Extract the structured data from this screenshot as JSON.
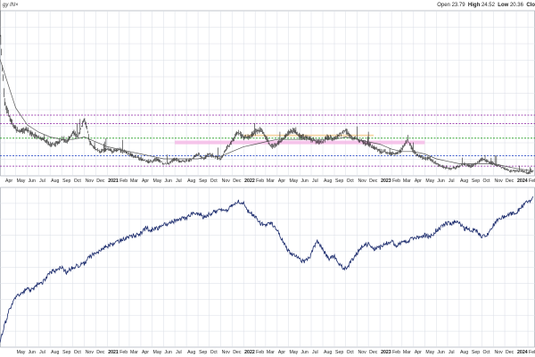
{
  "header": {
    "symbol_label": "gy IN×",
    "open_label": "Open",
    "open_value": "23.79",
    "high_label": "High",
    "high_value": "24.52",
    "low_label": "Low",
    "low_value": "20.36",
    "close_label": "Clo"
  },
  "colors": {
    "price_bar": "#111111",
    "moving_average": "#555555",
    "line_chart": "#1a2a6c",
    "grid": "#d9dde6",
    "level_purple": "#8a1fa0",
    "level_green": "#1a9a1a",
    "level_blue": "#3050c8",
    "band_pink": "#f5b8e6",
    "band_orange": "#f7d09a"
  },
  "chart_data": [
    {
      "type": "line",
      "panel": "upper",
      "series": [
        {
          "style": "price-bars",
          "x": [
            "2020-03-20",
            "2020-04-01",
            "2020-04-15",
            "2020-05-01",
            "2020-05-15",
            "2020-06-01",
            "2020-06-15",
            "2020-07-01",
            "2020-07-15",
            "2020-08-01",
            "2020-08-15",
            "2020-09-01",
            "2020-09-15",
            "2020-10-01",
            "2020-10-15",
            "2020-11-01",
            "2020-11-15",
            "2020-12-01",
            "2020-12-15",
            "2021-01-01",
            "2021-01-15",
            "2021-02-01",
            "2021-02-15",
            "2021-03-01",
            "2021-03-15",
            "2021-04-01",
            "2021-04-15",
            "2021-05-01",
            "2021-05-15",
            "2021-06-01",
            "2021-06-15",
            "2021-07-01",
            "2021-07-15",
            "2021-08-01",
            "2021-08-15",
            "2021-09-01",
            "2021-09-15",
            "2021-10-01",
            "2021-10-15",
            "2021-11-01",
            "2021-11-15",
            "2021-12-01",
            "2021-12-15",
            "2022-01-01",
            "2022-01-15",
            "2022-02-01",
            "2022-02-15",
            "2022-03-01",
            "2022-03-15",
            "2022-04-01",
            "2022-04-15",
            "2022-05-01",
            "2022-05-15",
            "2022-06-01",
            "2022-06-15",
            "2022-07-01",
            "2022-07-15",
            "2022-08-01",
            "2022-08-15",
            "2022-09-01",
            "2022-09-15",
            "2022-10-01",
            "2022-10-15",
            "2022-11-01",
            "2022-11-15",
            "2022-12-01",
            "2022-12-15",
            "2023-01-01",
            "2023-01-15",
            "2023-02-01",
            "2023-02-15",
            "2023-03-01",
            "2023-03-15",
            "2023-04-01",
            "2023-04-15",
            "2023-05-01",
            "2023-05-15",
            "2023-06-01",
            "2023-06-15",
            "2023-07-01",
            "2023-07-15",
            "2023-08-01",
            "2023-08-15",
            "2023-09-01",
            "2023-09-15",
            "2023-10-01",
            "2023-10-15",
            "2023-11-01",
            "2023-11-15",
            "2023-12-01",
            "2023-12-15",
            "2024-01-01",
            "2024-01-15",
            "2024-02-01",
            "2024-02-15"
          ],
          "values": [
            72,
            42,
            36,
            31,
            30,
            31,
            29,
            28,
            27,
            25,
            25,
            27,
            26,
            30,
            28,
            36,
            26,
            23,
            22,
            23,
            22,
            23,
            22,
            21,
            20,
            19,
            18,
            18,
            19,
            17,
            17,
            19,
            18,
            18,
            19,
            21,
            19,
            21,
            20,
            19,
            23,
            26,
            30,
            28,
            28,
            30,
            31,
            28,
            24,
            25,
            27,
            30,
            31,
            28,
            28,
            27,
            26,
            26,
            28,
            27,
            29,
            31,
            28,
            27,
            26,
            25,
            24,
            22,
            22,
            21,
            21,
            23,
            27,
            22,
            20,
            19,
            19,
            17,
            16,
            15,
            15,
            16,
            17,
            16,
            17,
            19,
            18,
            17,
            16,
            15,
            14,
            14,
            14,
            13,
            14
          ]
        },
        {
          "style": "moving-average",
          "x": [
            "2020-03-20",
            "2020-05-01",
            "2020-06-01",
            "2020-07-01",
            "2020-08-01",
            "2020-09-01",
            "2020-10-01",
            "2020-11-01",
            "2020-12-01",
            "2021-01-01",
            "2021-02-01",
            "2021-03-01",
            "2021-04-01",
            "2021-05-01",
            "2021-06-01",
            "2021-07-01",
            "2021-08-01",
            "2021-09-01",
            "2021-10-01",
            "2021-11-01",
            "2021-12-01",
            "2022-01-01",
            "2022-02-01",
            "2022-03-01",
            "2022-04-01",
            "2022-05-01",
            "2022-06-01",
            "2022-07-01",
            "2022-08-01",
            "2022-09-01",
            "2022-10-01",
            "2022-11-01",
            "2022-12-01",
            "2023-01-01",
            "2023-02-01",
            "2023-03-01",
            "2023-04-01",
            "2023-05-01",
            "2023-06-01",
            "2023-07-01",
            "2023-08-01",
            "2023-09-01",
            "2023-10-01",
            "2023-11-01",
            "2023-12-01",
            "2024-01-01",
            "2024-02-15"
          ],
          "values": [
            60,
            40,
            33,
            30,
            28,
            27,
            27,
            28,
            26,
            24,
            23,
            22,
            21,
            20,
            19,
            19,
            19,
            19,
            20,
            20,
            22,
            24,
            25,
            26,
            27,
            27,
            27,
            27,
            27,
            27,
            28,
            27,
            26,
            25,
            23,
            22,
            22,
            21,
            19,
            18,
            17,
            17,
            17,
            17,
            16,
            15,
            14
          ]
        }
      ],
      "levels": [
        {
          "kind": "purple-dotted",
          "value": 37
        },
        {
          "kind": "purple-dotted",
          "value": 33.5
        },
        {
          "kind": "green-dotted",
          "value": 27.5
        },
        {
          "kind": "pink-band",
          "from": 25,
          "to": 26.5
        },
        {
          "kind": "orange-band",
          "from": 28.3,
          "to": 29
        },
        {
          "kind": "blue-dotted",
          "value": 20.3
        },
        {
          "kind": "purple-dotted",
          "value": 16
        }
      ],
      "ylim": [
        12,
        80
      ],
      "grid": true
    },
    {
      "type": "line",
      "panel": "lower",
      "series": [
        {
          "style": "line",
          "x": [
            "2020-03-20",
            "2020-04-01",
            "2020-04-15",
            "2020-05-01",
            "2020-05-15",
            "2020-06-01",
            "2020-06-15",
            "2020-07-01",
            "2020-07-15",
            "2020-08-01",
            "2020-08-15",
            "2020-09-01",
            "2020-09-15",
            "2020-10-01",
            "2020-10-15",
            "2020-11-01",
            "2020-11-15",
            "2020-12-01",
            "2020-12-15",
            "2021-01-01",
            "2021-01-15",
            "2021-02-01",
            "2021-02-15",
            "2021-03-01",
            "2021-03-15",
            "2021-04-01",
            "2021-04-15",
            "2021-05-01",
            "2021-05-15",
            "2021-06-01",
            "2021-06-15",
            "2021-07-01",
            "2021-07-15",
            "2021-08-01",
            "2021-08-15",
            "2021-09-01",
            "2021-09-15",
            "2021-10-01",
            "2021-10-15",
            "2021-11-01",
            "2021-11-15",
            "2021-12-01",
            "2021-12-15",
            "2022-01-01",
            "2022-01-15",
            "2022-02-01",
            "2022-02-15",
            "2022-03-01",
            "2022-03-15",
            "2022-04-01",
            "2022-04-15",
            "2022-05-01",
            "2022-05-15",
            "2022-06-01",
            "2022-06-15",
            "2022-07-01",
            "2022-07-15",
            "2022-08-01",
            "2022-08-15",
            "2022-09-01",
            "2022-09-15",
            "2022-10-01",
            "2022-10-15",
            "2022-11-01",
            "2022-11-15",
            "2022-12-01",
            "2022-12-15",
            "2023-01-01",
            "2023-01-15",
            "2023-02-01",
            "2023-02-15",
            "2023-03-01",
            "2023-03-15",
            "2023-04-01",
            "2023-04-15",
            "2023-05-01",
            "2023-05-15",
            "2023-06-01",
            "2023-06-15",
            "2023-07-01",
            "2023-07-15",
            "2023-08-01",
            "2023-08-15",
            "2023-09-01",
            "2023-09-15",
            "2023-10-01",
            "2023-10-15",
            "2023-11-01",
            "2023-11-15",
            "2023-12-01",
            "2023-12-15",
            "2024-01-01",
            "2024-01-15",
            "2024-02-01",
            "2024-02-15"
          ],
          "values": [
            4.0,
            12,
            22,
            28,
            30,
            33,
            32,
            36,
            37,
            42,
            43,
            45,
            42,
            45,
            46,
            47,
            51,
            53,
            55,
            57,
            58,
            60,
            61,
            62,
            63,
            64,
            67,
            66,
            67,
            69,
            70,
            71,
            72,
            73,
            75,
            76,
            73,
            75,
            76,
            78,
            77,
            80,
            82,
            81,
            76,
            74,
            70,
            68,
            70,
            66,
            60,
            54,
            52,
            49,
            48,
            52,
            60,
            55,
            50,
            51,
            46,
            44,
            48,
            53,
            57,
            58,
            55,
            56,
            58,
            60,
            57,
            59,
            60,
            61,
            62,
            63,
            62,
            66,
            68,
            70,
            70,
            70,
            67,
            66,
            66,
            62,
            63,
            69,
            72,
            74,
            75,
            76,
            79,
            82,
            84
          ],
          "ylim": [
            0,
            90
          ]
        }
      ],
      "grid": true
    }
  ],
  "axes": {
    "upper_ticks": [
      {
        "label": "Apr",
        "date": "2020-04-01"
      },
      {
        "label": "May",
        "date": "2020-05-01"
      },
      {
        "label": "Jun",
        "date": "2020-06-01"
      },
      {
        "label": "Jul",
        "date": "2020-07-01"
      },
      {
        "label": "Aug",
        "date": "2020-08-01"
      },
      {
        "label": "Sep",
        "date": "2020-09-01"
      },
      {
        "label": "Oct",
        "date": "2020-10-01"
      },
      {
        "label": "Nov",
        "date": "2020-11-01"
      },
      {
        "label": "Dec",
        "date": "2020-12-01"
      },
      {
        "label": "2021",
        "date": "2021-01-01",
        "year": true
      },
      {
        "label": "Feb",
        "date": "2021-02-01"
      },
      {
        "label": "Mar",
        "date": "2021-03-01"
      },
      {
        "label": "Apr",
        "date": "2021-04-01"
      },
      {
        "label": "May",
        "date": "2021-05-01"
      },
      {
        "label": "Jun",
        "date": "2021-06-01"
      },
      {
        "label": "Jul",
        "date": "2021-07-01"
      },
      {
        "label": "Aug",
        "date": "2021-08-01"
      },
      {
        "label": "Sep",
        "date": "2021-09-01"
      },
      {
        "label": "Oct",
        "date": "2021-10-01"
      },
      {
        "label": "Nov",
        "date": "2021-11-01"
      },
      {
        "label": "Dec",
        "date": "2021-12-01"
      },
      {
        "label": "2022",
        "date": "2022-01-01",
        "year": true
      },
      {
        "label": "Feb",
        "date": "2022-02-01"
      },
      {
        "label": "Mar",
        "date": "2022-03-01"
      },
      {
        "label": "Apr",
        "date": "2022-04-01"
      },
      {
        "label": "May",
        "date": "2022-05-01"
      },
      {
        "label": "Jun",
        "date": "2022-06-01"
      },
      {
        "label": "Jul",
        "date": "2022-07-01"
      },
      {
        "label": "Aug",
        "date": "2022-08-01"
      },
      {
        "label": "Sep",
        "date": "2022-09-01"
      },
      {
        "label": "Oct",
        "date": "2022-10-01"
      },
      {
        "label": "Nov",
        "date": "2022-11-01"
      },
      {
        "label": "Dec",
        "date": "2022-12-01"
      },
      {
        "label": "2023",
        "date": "2023-01-01",
        "year": true
      },
      {
        "label": "Feb",
        "date": "2023-02-01"
      },
      {
        "label": "Mar",
        "date": "2023-03-01"
      },
      {
        "label": "Apr",
        "date": "2023-04-01"
      },
      {
        "label": "May",
        "date": "2023-05-01"
      },
      {
        "label": "Jun",
        "date": "2023-06-01"
      },
      {
        "label": "Jul",
        "date": "2023-07-01"
      },
      {
        "label": "Aug",
        "date": "2023-08-01"
      },
      {
        "label": "Sep",
        "date": "2023-09-01"
      },
      {
        "label": "Oct",
        "date": "2023-10-01"
      },
      {
        "label": "Nov",
        "date": "2023-11-01"
      },
      {
        "label": "Dec",
        "date": "2023-12-01"
      },
      {
        "label": "2024",
        "date": "2024-01-01",
        "year": true
      },
      {
        "label": "Feb",
        "date": "2024-02-01"
      }
    ],
    "lower_ticks": [
      {
        "label": "May",
        "date": "2020-05-01"
      },
      {
        "label": "Jun",
        "date": "2020-06-01"
      },
      {
        "label": "Jul",
        "date": "2020-07-01"
      },
      {
        "label": "Aug",
        "date": "2020-08-01"
      },
      {
        "label": "Sep",
        "date": "2020-09-01"
      },
      {
        "label": "Oct",
        "date": "2020-10-01"
      },
      {
        "label": "Nov",
        "date": "2020-11-01"
      },
      {
        "label": "Dec",
        "date": "2020-12-01"
      },
      {
        "label": "2021",
        "date": "2021-01-01",
        "year": true
      },
      {
        "label": "Feb",
        "date": "2021-02-01"
      },
      {
        "label": "Mar",
        "date": "2021-03-01"
      },
      {
        "label": "Apr",
        "date": "2021-04-01"
      },
      {
        "label": "May",
        "date": "2021-05-01"
      },
      {
        "label": "Jun",
        "date": "2021-06-01"
      },
      {
        "label": "Jul",
        "date": "2021-07-01"
      },
      {
        "label": "Aug",
        "date": "2021-08-01"
      },
      {
        "label": "Sep",
        "date": "2021-09-01"
      },
      {
        "label": "Oct",
        "date": "2021-10-01"
      },
      {
        "label": "Nov",
        "date": "2021-11-01"
      },
      {
        "label": "Dec",
        "date": "2021-12-01"
      },
      {
        "label": "2022",
        "date": "2022-01-01",
        "year": true
      },
      {
        "label": "Feb",
        "date": "2022-02-01"
      },
      {
        "label": "Mar",
        "date": "2022-03-01"
      },
      {
        "label": "Apr",
        "date": "2022-04-01"
      },
      {
        "label": "May",
        "date": "2022-05-01"
      },
      {
        "label": "Jun",
        "date": "2022-06-01"
      },
      {
        "label": "Jul",
        "date": "2022-07-01"
      },
      {
        "label": "Aug",
        "date": "2022-08-01"
      },
      {
        "label": "Sep",
        "date": "2022-09-01"
      },
      {
        "label": "Oct",
        "date": "2022-10-01"
      },
      {
        "label": "Nov",
        "date": "2022-11-01"
      },
      {
        "label": "Dec",
        "date": "2022-12-01"
      },
      {
        "label": "2023",
        "date": "2023-01-01",
        "year": true
      },
      {
        "label": "Feb",
        "date": "2023-02-01"
      },
      {
        "label": "Mar",
        "date": "2023-03-01"
      },
      {
        "label": "Apr",
        "date": "2023-04-01"
      },
      {
        "label": "May",
        "date": "2023-05-01"
      },
      {
        "label": "Jun",
        "date": "2023-06-01"
      },
      {
        "label": "Jul",
        "date": "2023-07-01"
      },
      {
        "label": "Aug",
        "date": "2023-08-01"
      },
      {
        "label": "Sep",
        "date": "2023-09-01"
      },
      {
        "label": "Oct",
        "date": "2023-10-01"
      },
      {
        "label": "Nov",
        "date": "2023-11-01"
      },
      {
        "label": "Dec",
        "date": "2023-12-01"
      },
      {
        "label": "2024",
        "date": "2024-01-01",
        "year": true
      },
      {
        "label": "Feb",
        "date": "2024-02-01"
      }
    ]
  }
}
